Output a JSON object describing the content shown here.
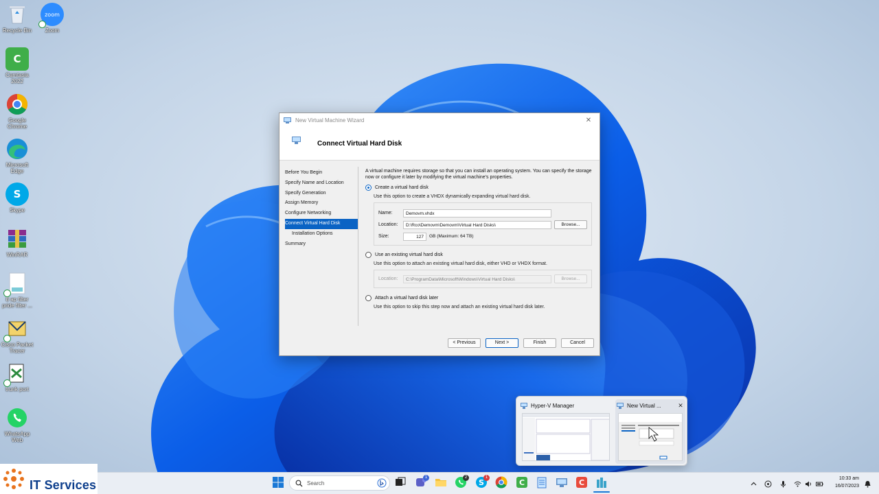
{
  "desktop": {
    "icons": [
      {
        "label": "Recycle Bin",
        "icon": "recycle-bin-icon",
        "color": "#e9eef5"
      },
      {
        "label": "Zoom",
        "icon": "zoom-icon",
        "color": "#2d8cff",
        "glyph": "zoom"
      },
      {
        "label": "Camtasia 2022",
        "icon": "camtasia-icon",
        "color": "#3fae49",
        "glyph": "C"
      },
      {
        "label": "Google Chrome",
        "icon": "chrome-icon",
        "color": "#ffffff"
      },
      {
        "label": "Microsoft Edge",
        "icon": "edge-icon",
        "color": "#1a8fd6"
      },
      {
        "label": "Skype",
        "icon": "skype-icon",
        "color": "#00a8e8",
        "glyph": "S"
      },
      {
        "label": "WinRAR",
        "icon": "winrar-icon",
        "color": "#8b2d8e"
      },
      {
        "label": "8 ap filter pride filter ...",
        "icon": "document-icon",
        "color": "#ffffff"
      },
      {
        "label": "Cisco Packet Tracer",
        "icon": "packet-tracer-icon",
        "color": "#f0f0f0"
      },
      {
        "label": "trunk port",
        "icon": "packet-tracer-file-icon",
        "color": "#f0f0f0"
      },
      {
        "label": "WhatsApp Web",
        "icon": "whatsapp-icon",
        "color": "#25d366"
      }
    ]
  },
  "wizard": {
    "window_title": "New Virtual Machine Wizard",
    "page_title": "Connect Virtual Hard Disk",
    "steps": [
      {
        "label": "Before You Begin",
        "sub": false,
        "active": false
      },
      {
        "label": "Specify Name and Location",
        "sub": false,
        "active": false
      },
      {
        "label": "Specify Generation",
        "sub": false,
        "active": false
      },
      {
        "label": "Assign Memory",
        "sub": false,
        "active": false
      },
      {
        "label": "Configure Networking",
        "sub": false,
        "active": false
      },
      {
        "label": "Connect Virtual Hard Disk",
        "sub": false,
        "active": true
      },
      {
        "label": "Installation Options",
        "sub": true,
        "active": false
      },
      {
        "label": "Summary",
        "sub": false,
        "active": false
      }
    ],
    "description": "A virtual machine requires storage so that you can install an operating system. You can specify the storage now or configure it later by modifying the virtual machine's properties.",
    "option_create": {
      "label": "Create a virtual hard disk",
      "selected": true,
      "note": "Use this option to create a VHDX dynamically expanding virtual hard disk.",
      "name_label": "Name:",
      "name_value": "Demovm.vhdx",
      "location_label": "Location:",
      "location_value": "D:\\Rco\\Demovm\\Demovm\\Virtual Hard Disks\\",
      "browse_label": "Browse...",
      "size_label": "Size:",
      "size_value": "127",
      "size_unit": "GB (Maximum: 64 TB)"
    },
    "option_existing": {
      "label": "Use an existing virtual hard disk",
      "selected": false,
      "note": "Use this option to attach an existing virtual hard disk, either VHD or VHDX format.",
      "location_label": "Location:",
      "location_value": "C:\\ProgramData\\Microsoft\\Windows\\Virtual Hard Disks\\",
      "browse_label": "Browse..."
    },
    "option_later": {
      "label": "Attach a virtual hard disk later",
      "selected": false,
      "note": "Use this option to skip this step now and attach an existing virtual hard disk later."
    },
    "buttons": {
      "previous": "< Previous",
      "next": "Next >",
      "finish": "Finish",
      "cancel": "Cancel"
    },
    "accent": "#0a63c4"
  },
  "taskbar_preview": {
    "window1": "Hyper-V Manager",
    "window2": "New Virtual ...",
    "close": "✕"
  },
  "taskbar": {
    "brand": "IT Services",
    "search_placeholder": "Search",
    "icons": [
      "start-icon",
      "search-icon",
      "task-view-icon",
      "teams-icon",
      "file-explorer-icon",
      "whatsapp-icon",
      "skype-icon",
      "chrome-icon",
      "camtasia-icon",
      "notepad-icon",
      "hyper-v-manager-icon",
      "camtasia-recorder-icon",
      "vm-connect-icon"
    ],
    "badges": {
      "teams": "1",
      "whatsapp": "2",
      "skype": "1"
    },
    "time": "10:33 am",
    "date": "16/07/2023"
  }
}
